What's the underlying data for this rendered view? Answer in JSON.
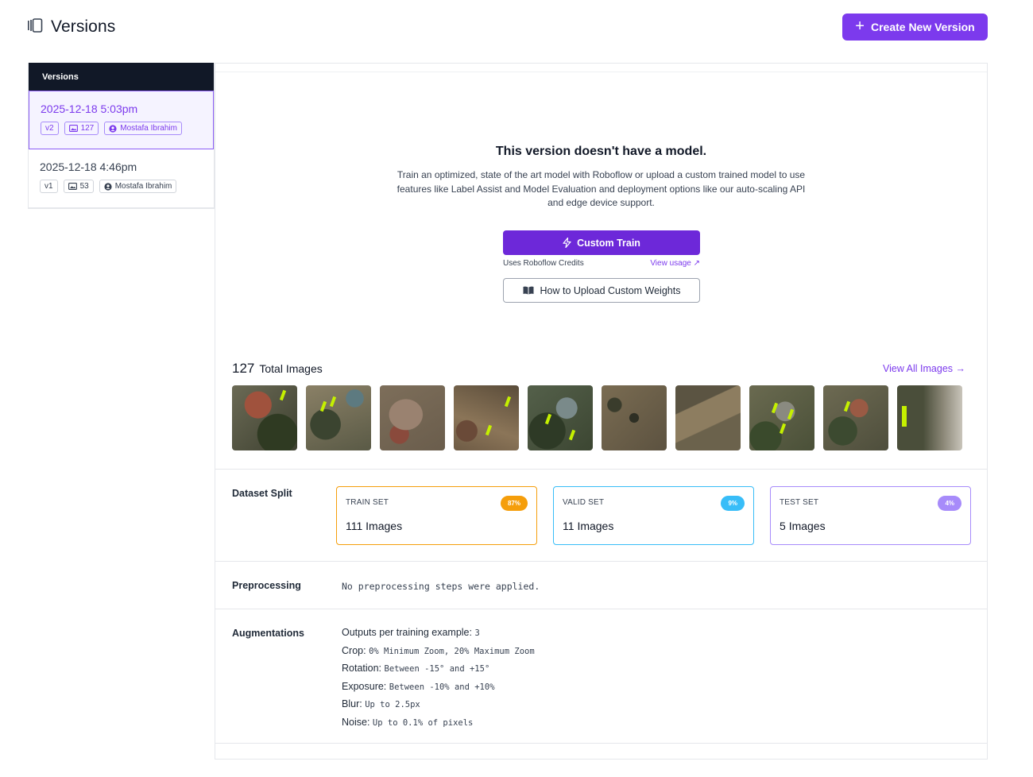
{
  "header": {
    "title": "Versions",
    "create_button": "Create New Version"
  },
  "sidebar": {
    "title": "Versions",
    "items": [
      {
        "date": "2025-12-18 5:03pm",
        "version": "v2",
        "images": "127",
        "author": "Mostafa Ibrahim",
        "active": true
      },
      {
        "date": "2025-12-18 4:46pm",
        "version": "v1",
        "images": "53",
        "author": "Mostafa Ibrahim",
        "active": false
      }
    ]
  },
  "no_model": {
    "heading": "This version doesn't have a model.",
    "description": "Train an optimized, state of the art model with Roboflow or upload a custom trained model to use features like Label Assist and Model Evaluation and deployment options like our auto-scaling API and edge device support.",
    "train_button": "Custom Train",
    "credits_text": "Uses Roboflow Credits",
    "view_usage": "View usage ↗",
    "upload_button": "How to Upload Custom Weights"
  },
  "images": {
    "count": "127",
    "label": "Total Images",
    "view_all": "View All Images →",
    "thumbnails": [
      "aerial-1",
      "aerial-2",
      "aerial-3",
      "aerial-4",
      "aerial-5",
      "aerial-6",
      "aerial-7",
      "aerial-8",
      "aerial-9",
      "aerial-10"
    ]
  },
  "dataset_split": {
    "label": "Dataset Split",
    "train": {
      "title": "TRAIN SET",
      "pct": "87%",
      "count": "111",
      "unit": "Images",
      "color": "#f59e0b"
    },
    "valid": {
      "title": "VALID SET",
      "pct": "9%",
      "count": "11",
      "unit": "Images",
      "color": "#38bdf8"
    },
    "test": {
      "title": "TEST SET",
      "pct": "4%",
      "count": "5",
      "unit": "Images",
      "color": "#a78bfa"
    }
  },
  "preprocessing": {
    "label": "Preprocessing",
    "text": "No preprocessing steps were applied."
  },
  "augmentations": {
    "label": "Augmentations",
    "items": [
      {
        "name": "Outputs per training example:",
        "value": "3"
      },
      {
        "name": "Crop:",
        "value": "0% Minimum Zoom, 20% Maximum Zoom"
      },
      {
        "name": "Rotation:",
        "value": "Between -15° and +15°"
      },
      {
        "name": "Exposure:",
        "value": "Between -10% and +10%"
      },
      {
        "name": "Blur:",
        "value": "Up to 2.5px"
      },
      {
        "name": "Noise:",
        "value": "Up to 0.1% of pixels"
      }
    ]
  },
  "colors": {
    "accent": "#7c3aed",
    "sidebar_head": "#111827"
  }
}
